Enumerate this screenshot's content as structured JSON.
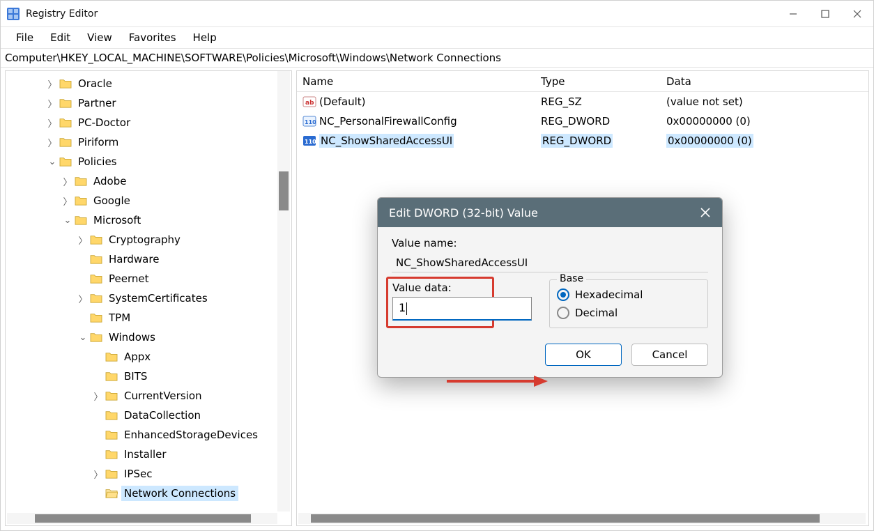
{
  "title": "Registry Editor",
  "menu": {
    "file": "File",
    "edit": "Edit",
    "view": "View",
    "favorites": "Favorites",
    "help": "Help"
  },
  "address": "Computer\\HKEY_LOCAL_MACHINE\\SOFTWARE\\Policies\\Microsoft\\Windows\\Network Connections",
  "tree": {
    "oracle": "Oracle",
    "partner": "Partner",
    "pcdoctor": "PC-Doctor",
    "piriform": "Piriform",
    "policies": "Policies",
    "adobe": "Adobe",
    "google": "Google",
    "microsoft": "Microsoft",
    "cryptography": "Cryptography",
    "hardware": "Hardware",
    "peernet": "Peernet",
    "systemcert": "SystemCertificates",
    "tpm": "TPM",
    "windows": "Windows",
    "appx": "Appx",
    "bits": "BITS",
    "currentversion": "CurrentVersion",
    "datacollection": "DataCollection",
    "esd": "EnhancedStorageDevices",
    "installer": "Installer",
    "ipsec": "IPSec",
    "netconn": "Network Connections"
  },
  "list": {
    "headers": {
      "name": "Name",
      "type": "Type",
      "data": "Data"
    },
    "rows": [
      {
        "icon": "sz",
        "name": "(Default)",
        "type": "REG_SZ",
        "data": "(value not set)"
      },
      {
        "icon": "dw",
        "name": "NC_PersonalFirewallConfig",
        "type": "REG_DWORD",
        "data": "0x00000000 (0)"
      },
      {
        "icon": "dw",
        "name": "NC_ShowSharedAccessUI",
        "type": "REG_DWORD",
        "data": "0x00000000 (0)",
        "sel": true
      }
    ]
  },
  "dialog": {
    "title": "Edit DWORD (32-bit) Value",
    "valueNameLabel": "Value name:",
    "valueName": "NC_ShowSharedAccessUI",
    "valueDataLabel": "Value data:",
    "valueData": "1",
    "baseLabel": "Base",
    "hex": "Hexadecimal",
    "dec": "Decimal",
    "ok": "OK",
    "cancel": "Cancel"
  }
}
